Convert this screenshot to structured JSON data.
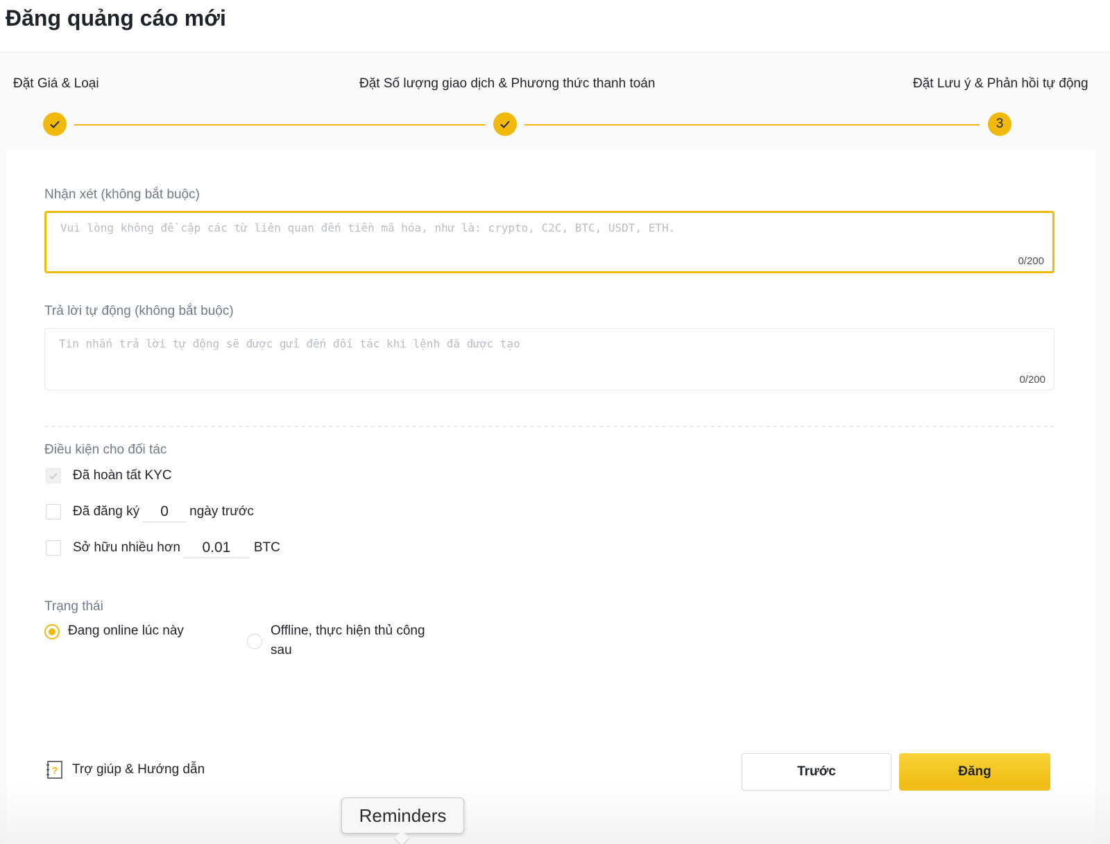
{
  "header": {
    "title": "Đăng quảng cáo mới"
  },
  "steps": [
    {
      "label": "Đặt Giá & Loại",
      "state": "done"
    },
    {
      "label": "Đặt Số lượng giao dịch & Phương thức thanh toán",
      "state": "done"
    },
    {
      "label": "Đặt Lưu ý & Phản hồi tự động",
      "state": "current",
      "number": "3"
    }
  ],
  "remarks": {
    "label": "Nhận xét (không bắt buộc)",
    "placeholder": "Vui lòng không đề cập các từ liên quan đến tiền mã hóa, như là: crypto, C2C, BTC, USDT, ETH.",
    "value": "",
    "counter": "0/200"
  },
  "auto_reply": {
    "label": "Trả lời tự động (không bắt buộc)",
    "placeholder": "Tin nhắn trả lời tự động sẽ được gửi đến đối tác khi lệnh đã được tạo",
    "value": "",
    "counter": "0/200"
  },
  "conditions": {
    "label": "Điều kiện cho đối tác",
    "kyc": {
      "label": "Đã hoàn tất KYC",
      "checked": true,
      "disabled": true
    },
    "registered": {
      "prefix": "Đã đăng ký",
      "value": "0",
      "suffix": "ngày trước",
      "checked": false
    },
    "holding": {
      "prefix": "Sở hữu nhiều hơn",
      "value": "0.01",
      "suffix": "BTC",
      "checked": false
    }
  },
  "status": {
    "label": "Trạng thái",
    "online": {
      "label": "Đang online lúc này",
      "selected": true
    },
    "offline": {
      "label_line1": "Offline, thực hiện thủ công",
      "label_line2": "sau",
      "selected": false
    }
  },
  "footer": {
    "help_label": "Trợ giúp & Hướng dẫn",
    "prev_label": "Trước",
    "post_label": "Đăng"
  },
  "tooltip": {
    "text": "Reminders"
  },
  "colors": {
    "accent": "#f0b90b",
    "text": "#1e2329",
    "muted": "#707a8a"
  }
}
